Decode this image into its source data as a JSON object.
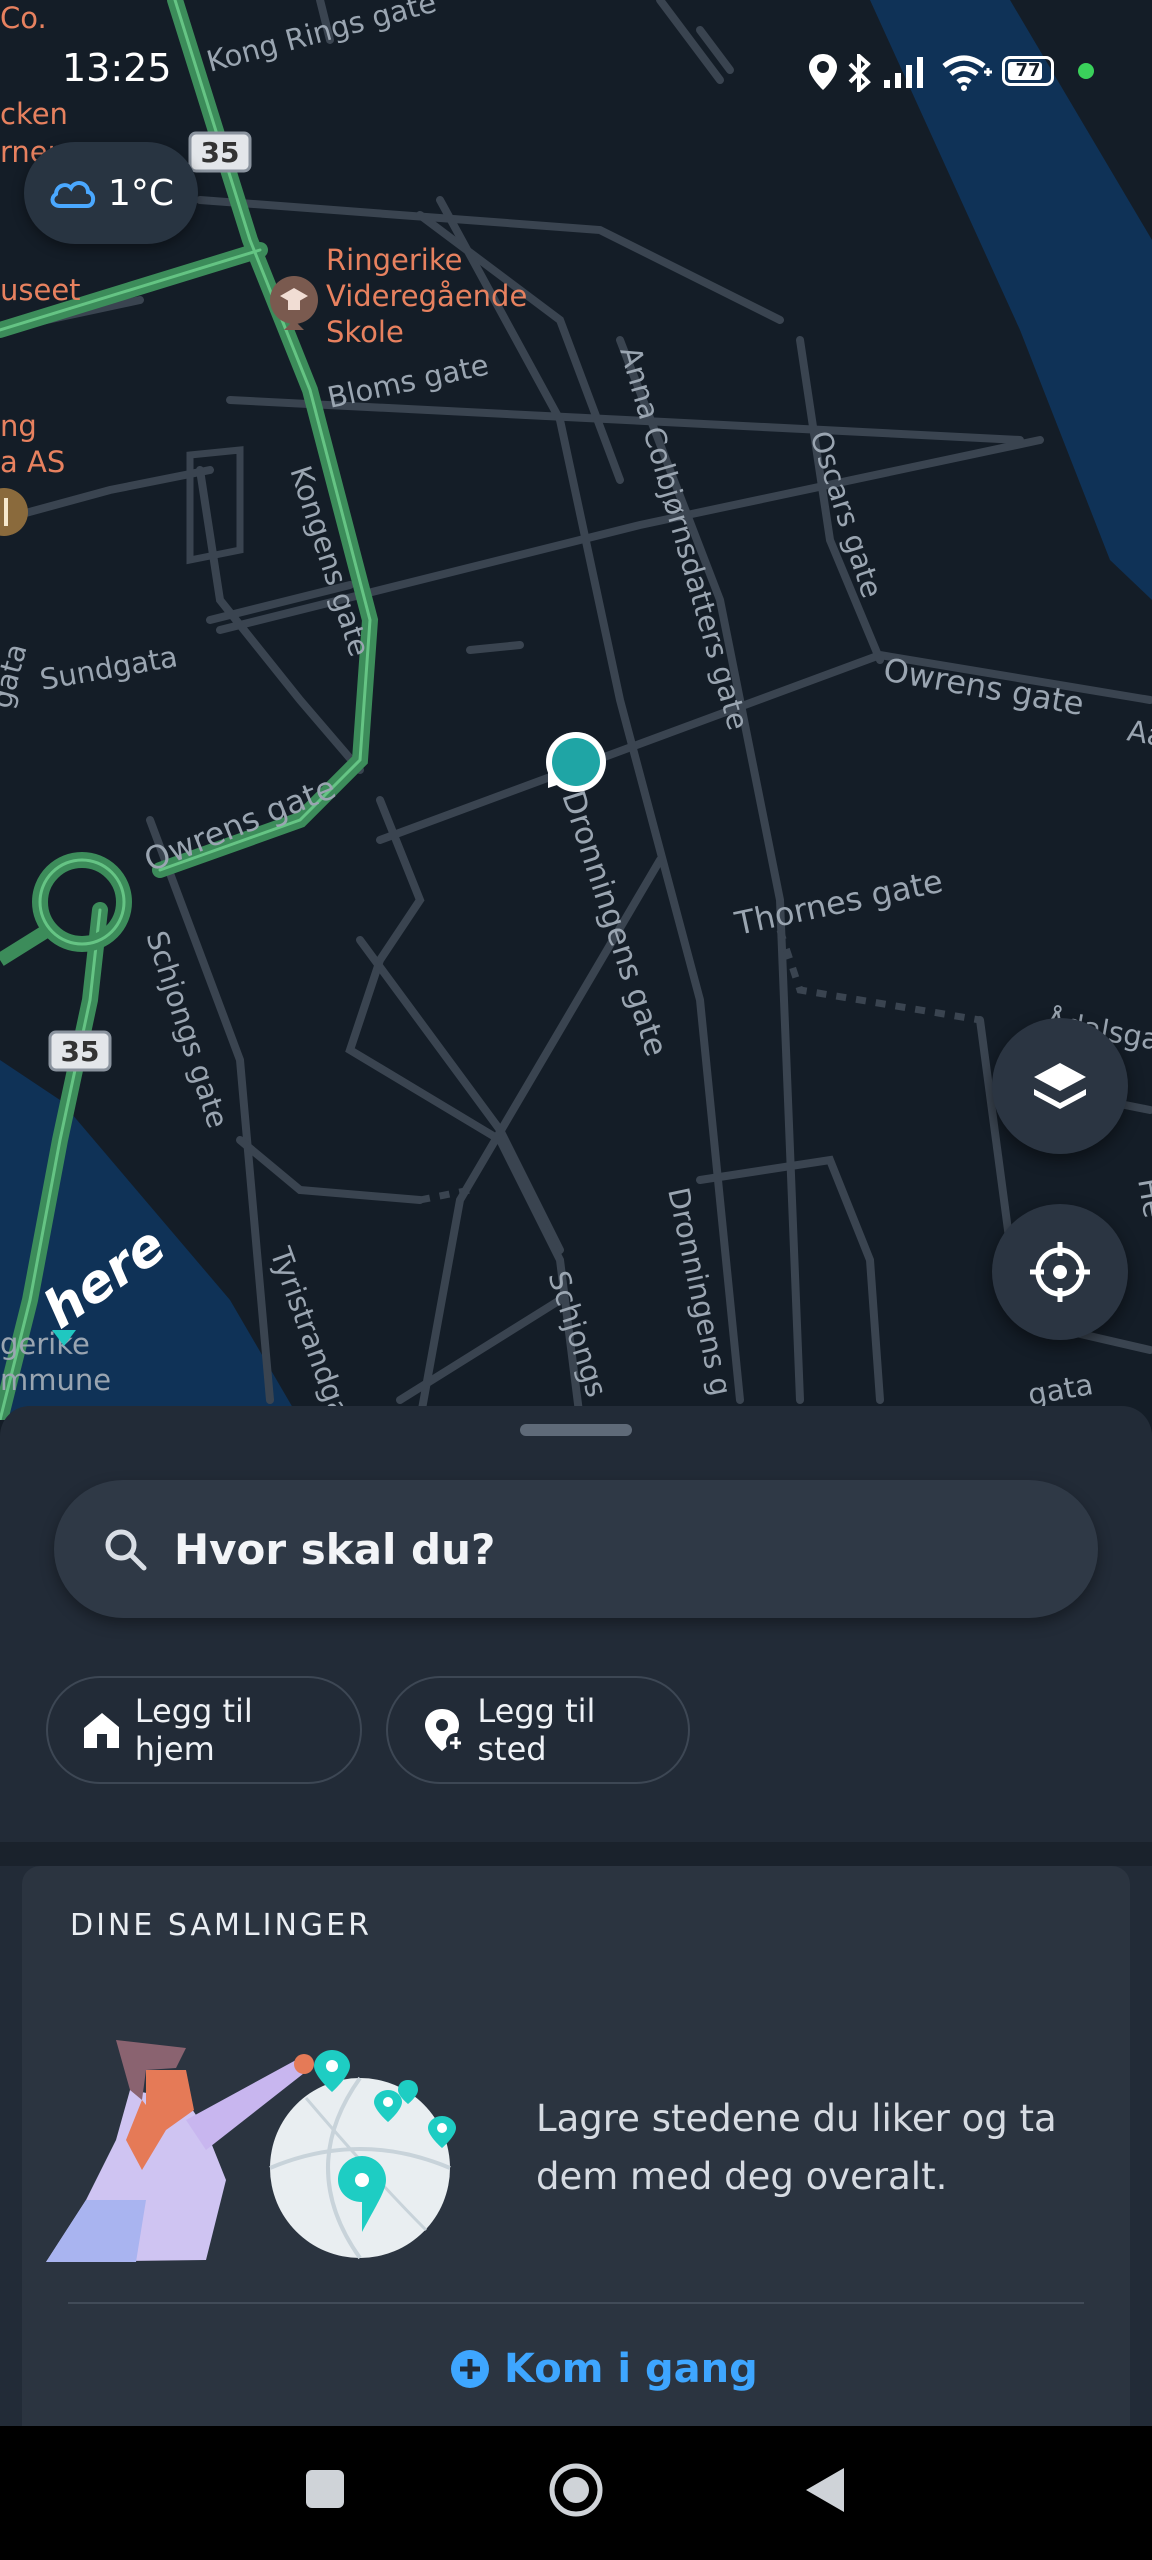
{
  "status": {
    "time": "13:25",
    "battery": "77"
  },
  "weather": {
    "temp": "1°C",
    "icon": "cloud-icon"
  },
  "map": {
    "labels": {
      "kong_rings_gate": "Kong Rings gate",
      "co": "Co.",
      "cken": "cken",
      "rner": "rner",
      "useet": "useet",
      "ng": "ng",
      "a_as": "a AS",
      "school": [
        "Ringerike",
        "Videregående",
        "Skole"
      ],
      "bloms_gate": "Bloms gate",
      "kongens_gate": "Kongens gate",
      "anna_colbjornsdatters_gate": "Anna Colbjørnsdatters gate",
      "oscars_gate": "Oscars gate",
      "sundgata": "Sundgata",
      "gata": "gata",
      "owrens_gate_1": "Owrens gate",
      "owrens_gate_2": "Owrens gate",
      "aa": "Aa",
      "dronningens_gate_1": "Dronningens gate",
      "dronningens_gate_2": "Dronningens g",
      "thornes_gate": "Thornes gate",
      "schjongs_gate_1": "Schjongs gate",
      "schjongs_gate_2": "Schjongs",
      "tyristrandg": "Tyristrandga",
      "adalsg": "Ådalsga",
      "gata_right": "gata",
      "he": "He",
      "gerike": "gerike",
      "mmune": "mmune",
      "route35_top": "35",
      "route35_bottom": "35",
      "here_logo": "here"
    },
    "accent": "#1fa5a5"
  },
  "fabs": {
    "layers_icon": "layers-icon",
    "locate_icon": "crosshair-icon"
  },
  "search": {
    "placeholder": "Hvor skal du?"
  },
  "chips": [
    {
      "label": "Legg til hjem",
      "icon": "home-icon"
    },
    {
      "label": "Legg til sted",
      "icon": "add-location-icon"
    }
  ],
  "collections": {
    "title": "DINE SAMLINGER",
    "description": "Lagre stedene du liker og ta dem med deg overalt.",
    "cta": "Kom i gang"
  },
  "colors": {
    "link": "#3ea6ff",
    "teal": "#20c7c0"
  }
}
